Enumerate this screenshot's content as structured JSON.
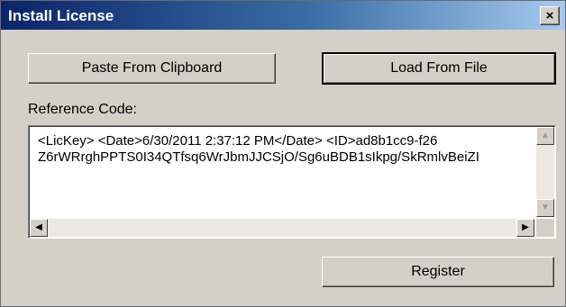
{
  "window": {
    "title": "Install License",
    "close_glyph": "×"
  },
  "buttons": {
    "paste": "Paste From Clipboard",
    "load": "Load From File",
    "register": "Register"
  },
  "reference": {
    "label": "Reference Code:",
    "line1": "<LicKey>  <Date>6/30/2011 2:37:12 PM</Date>  <ID>ad8b1cc9-f26",
    "line2": "Z6rWRrghPPTS0I34QTfsq6WrJbmJJCSjO/Sg6uBDB1sIkpg/SkRmlvBeiZI"
  },
  "scrollbars": {
    "up_glyph": "▲",
    "down_glyph": "▼",
    "left_glyph": "◀",
    "right_glyph": "▶"
  }
}
